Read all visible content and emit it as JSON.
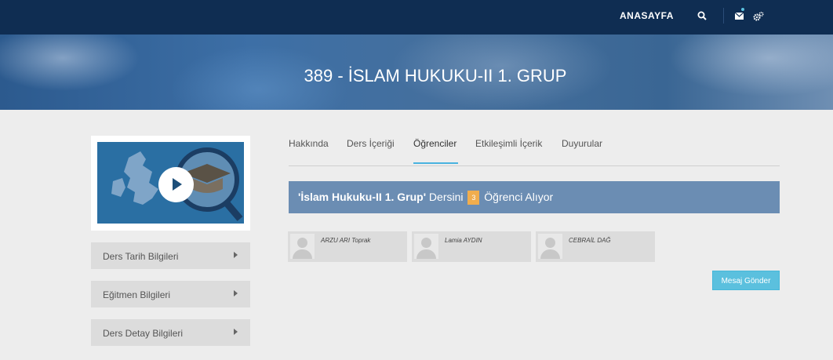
{
  "nav": {
    "home_label": "ANASAYFA",
    "icons": [
      "search-icon",
      "mail-icon",
      "settings-icon"
    ]
  },
  "hero": {
    "title": "389 - İSLAM HUKUKU-II 1. GRUP"
  },
  "sidebar": {
    "items": [
      {
        "label": "Ders Tarih Bilgileri"
      },
      {
        "label": "Eğitmen Bilgileri"
      },
      {
        "label": "Ders Detay Bilgileri"
      }
    ]
  },
  "tabs": [
    {
      "label": "Hakkında"
    },
    {
      "label": "Ders İçeriği"
    },
    {
      "label": "Öğrenciler",
      "active": true
    },
    {
      "label": "Etkileşimli İçerik"
    },
    {
      "label": "Duyurular"
    }
  ],
  "banner": {
    "course": "'İslam Hukuku-II 1. Grup'",
    "text_before": " Dersini ",
    "count": "3",
    "text_after": " Öğrenci Alıyor"
  },
  "students": [
    {
      "name": "ARZU ARI Toprak"
    },
    {
      "name": "Lamia AYDIN"
    },
    {
      "name": "CEBRAİL DAĞ"
    }
  ],
  "actions": {
    "send_message": "Mesaj Gönder"
  },
  "colors": {
    "nav": "#0f2d52",
    "banner": "#6b8db3",
    "accent": "#5bc0de",
    "count_badge": "#f0ad4e"
  }
}
